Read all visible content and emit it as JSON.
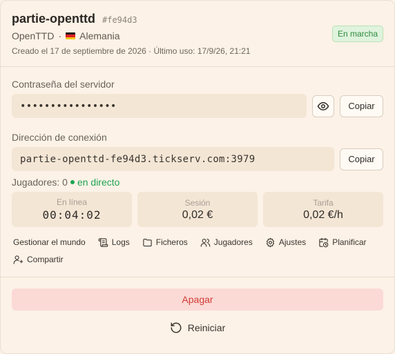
{
  "server": {
    "name": "partie-openttd",
    "id": "#fe94d3",
    "game": "OpenTTD",
    "separator": "·",
    "country": "Alemania",
    "meta": "Creado el 17 de septiembre de 2026 · Último uso: 17/9/26, 21:21",
    "status": "En marcha"
  },
  "password": {
    "label": "Contraseña del servidor",
    "masked": "••••••••••••••••",
    "copy": "Copiar"
  },
  "address": {
    "label": "Dirección de conexión",
    "value": "partie-openttd-fe94d3.tickserv.com:3979",
    "copy": "Copiar"
  },
  "players": {
    "label": "Jugadores: 0",
    "live": "en directo"
  },
  "stats": [
    {
      "label": "En línea",
      "value": "00:04:02"
    },
    {
      "label": "Sesión",
      "value": "0,02 €"
    },
    {
      "label": "Tarifa",
      "value": "0,02 €/h"
    }
  ],
  "actions": {
    "manage_world": "Gestionar el mundo",
    "logs": "Logs",
    "files": "Ficheros",
    "players": "Jugadores",
    "settings": "Ajustes",
    "schedule": "Planificar",
    "share": "Compartir"
  },
  "footer": {
    "stop": "Apagar",
    "restart": "Reiniciar"
  },
  "colors": {
    "background": "#fcf2e7",
    "status_green": "#2d8a3c",
    "live_green": "#1ea453",
    "danger": "#d23b35",
    "danger_bg": "#fbdad6"
  }
}
